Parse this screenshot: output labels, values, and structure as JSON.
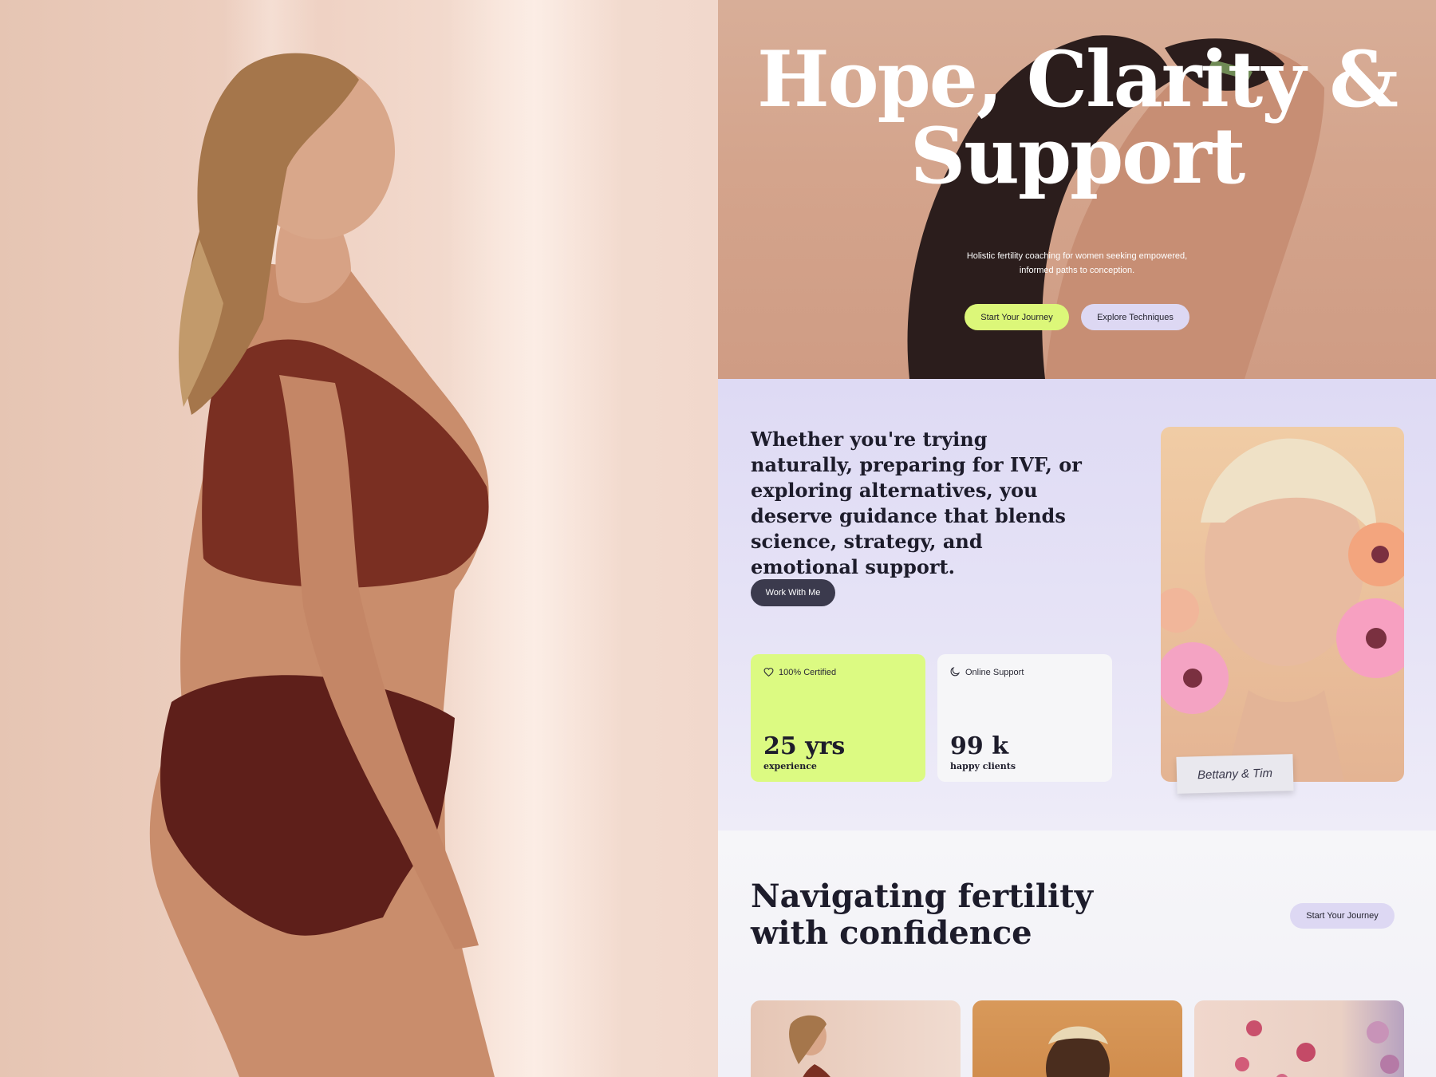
{
  "hero": {
    "title_line1": "Hope, Clarity &",
    "title_line2": "Support",
    "subtitle": "Holistic fertility coaching for women seeking empowered, informed paths to conception.",
    "primary_cta": "Start Your Journey",
    "secondary_cta": "Explore Techniques"
  },
  "intro": {
    "text": "Whether you're trying naturally, preparing for IVF, or exploring alternatives, you deserve guidance that blends science, strategy, and emotional support.",
    "cta": "Work With Me",
    "cards": [
      {
        "tag": "100% Certified",
        "icon": "heart-icon",
        "value": "25 yrs",
        "caption": "experience",
        "color": "#dcfa82"
      },
      {
        "tag": "Online Support",
        "icon": "moon-icon",
        "value": "99 k",
        "caption": "happy clients",
        "color": "#f6f6f8"
      }
    ],
    "portrait_note": "Bettany & Tim"
  },
  "navigating": {
    "title": "Navigating fertility with confidence",
    "cta": "Start Your Journey"
  },
  "colors": {
    "lime": "#dcf779",
    "lavender": "#ddd8f3",
    "dark": "#3b3a4d",
    "text": "#1d1c2b"
  }
}
